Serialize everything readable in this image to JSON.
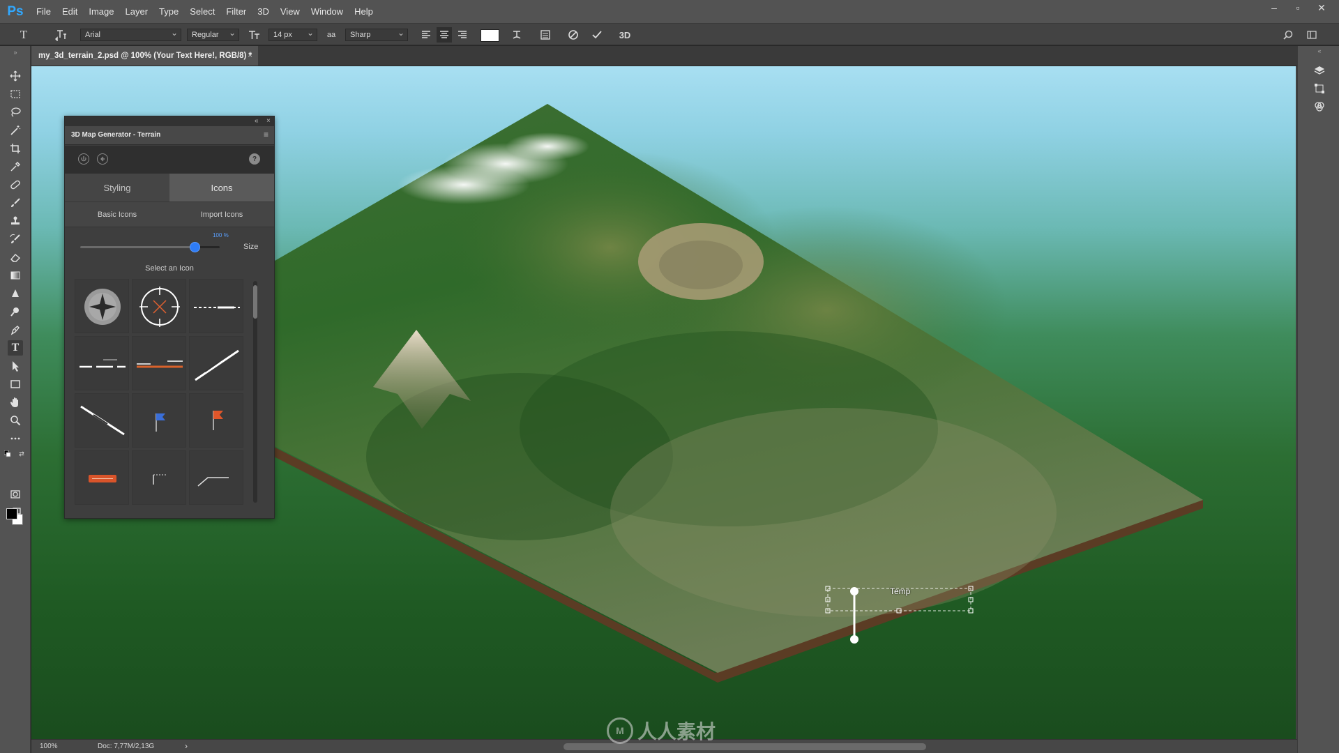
{
  "app": {
    "logo": "Ps"
  },
  "menu": [
    "File",
    "Edit",
    "Image",
    "Layer",
    "Type",
    "Select",
    "Filter",
    "3D",
    "View",
    "Window",
    "Help"
  ],
  "window_controls": [
    "–",
    "▫",
    "✕"
  ],
  "options_bar": {
    "font_family": "Arial",
    "font_style": "Regular",
    "font_size": "14 px",
    "antialias_icon_text": "aa",
    "antialias": "Sharp",
    "three_d_label": "3D",
    "text_color": "#ffffff"
  },
  "document_tab": {
    "title": "my_3d_terrain_2.psd @ 100% (Your Text Here!, RGB/8) *",
    "close": "×"
  },
  "status_bar": {
    "zoom": "100%",
    "doc_size": "Doc: 7,77M/2,13G",
    "arrow": "›"
  },
  "panel": {
    "title": "3D Map Generator - Terrain",
    "menu_icon": "≡",
    "collapse_icon": "«",
    "close_icon": "×",
    "tabs": [
      {
        "label": "Styling",
        "active": false
      },
      {
        "label": "Icons",
        "active": true
      }
    ],
    "subtabs": [
      "Basic Icons",
      "Import Icons"
    ],
    "size_slider": {
      "value_text": "100 %",
      "label": "Size",
      "value_fraction": 0.82,
      "accent": "#2e7cf6"
    },
    "select_label": "Select an Icon",
    "icons": [
      "compass-rose-icon",
      "compass-target-icon",
      "dashed-line-icon",
      "line-label-icon",
      "orange-line-label-icon",
      "diagonal-line-icon",
      "diagonal-line-down-icon",
      "blue-flag-icon",
      "orange-flag-icon",
      "orange-banner-icon",
      "small-pin-line-icon",
      "bent-line-icon"
    ]
  },
  "canvas": {
    "pin_label": "Temp"
  },
  "watermark": {
    "logo_text": "M",
    "text": "人人素材"
  }
}
